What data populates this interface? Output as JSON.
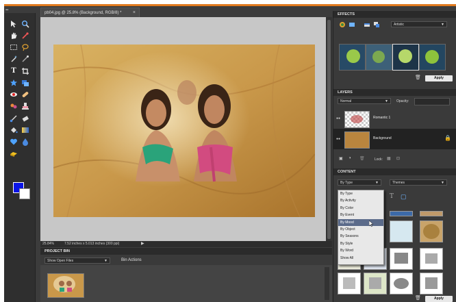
{
  "document": {
    "tab_title": "pb04.jpg @ 25.8% (Background, RGB/8) *",
    "close_glyph": "×"
  },
  "status": {
    "zoom": "25.84%",
    "info": "7.52 inches x 5.013 inches (300 ppi)",
    "arrow": "▶"
  },
  "project_bin": {
    "title": "PROJECT BIN",
    "show_select": "Show Open Files",
    "actions": "Bin Actions"
  },
  "effects": {
    "title": "EFFECTS",
    "filter_select": "Artistic",
    "apply": "Apply"
  },
  "layers": {
    "title": "LAYERS",
    "blend_mode": "Normal",
    "opacity_label": "Opacity:",
    "lock_label": "Lock:",
    "items": [
      {
        "name": "Romantic 1"
      },
      {
        "name": "Background"
      }
    ]
  },
  "content": {
    "title": "CONTENT",
    "sort_select": "By Type",
    "category_select": "Themes",
    "apply": "Apply",
    "menu": [
      {
        "label": "By Type"
      },
      {
        "label": "By Activity"
      },
      {
        "label": "By Color"
      },
      {
        "label": "By Event"
      },
      {
        "label": "By Mood"
      },
      {
        "label": "By Object"
      },
      {
        "label": "By Seasons"
      },
      {
        "label": "By Style"
      },
      {
        "label": "By Word"
      },
      {
        "label": "Show All"
      }
    ]
  },
  "colors": {
    "foreground": "#0a14e6",
    "background": "#ffffff",
    "accent": "#e07a1e"
  }
}
